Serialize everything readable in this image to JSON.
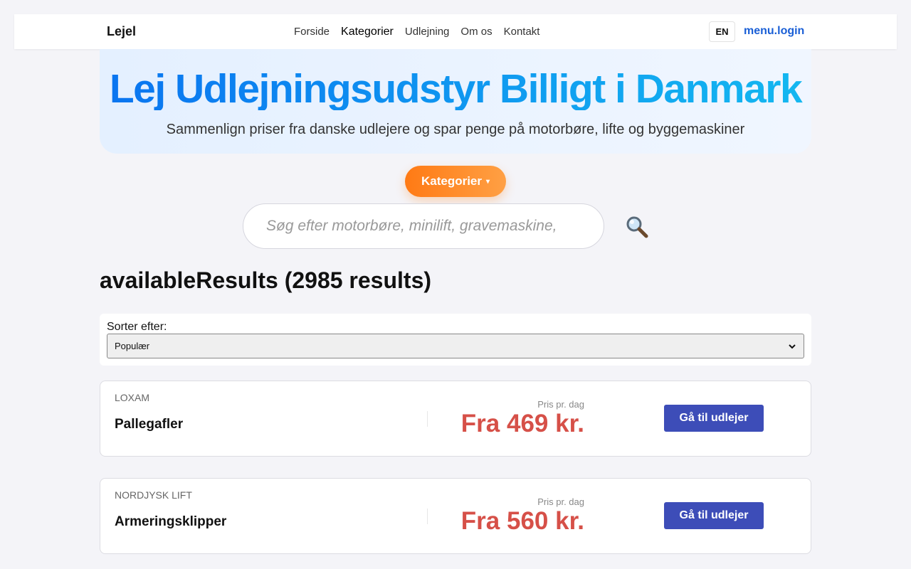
{
  "header": {
    "logo": "Lejel",
    "nav": [
      {
        "label": "Forside"
      },
      {
        "label": "Kategorier"
      },
      {
        "label": "Udlejning"
      },
      {
        "label": "Om os"
      },
      {
        "label": "Kontakt"
      }
    ],
    "active_nav": "Kategorier",
    "language": "EN",
    "login": "menu.login"
  },
  "hero": {
    "title": "Lej Udlejningsudstyr Billigt i Danmark",
    "subtitle": "Sammenlign priser fra danske udlejere og spar penge på motorbøre, lifte og byggemaskiner"
  },
  "category_button": {
    "label": "Kategorier",
    "caret": "▾"
  },
  "search": {
    "placeholder": "Søg efter motorbøre, minilift, gravemaskine, e",
    "value": "",
    "icon": "search-icon"
  },
  "results": {
    "title": "availableResults (2985 results)"
  },
  "sort": {
    "label": "Sorter efter:",
    "selected": "Populær"
  },
  "listings": [
    {
      "vendor": "LOXAM",
      "product": "Pallegafler",
      "price_label": "Pris pr. dag",
      "price": "Fra 469 kr.",
      "cta": "Gå til udlejer"
    },
    {
      "vendor": "NORDJYSK LIFT",
      "product": "Armeringsklipper",
      "price_label": "Pris pr. dag",
      "price": "Fra 560 kr.",
      "cta": "Gå til udlejer"
    }
  ],
  "colors": {
    "accent_orange": "#ff7a14",
    "title_blue": "#0a74f0",
    "price_red": "#d65048",
    "cta_blue": "#3d4db8",
    "login_blue": "#1a5fd6"
  }
}
